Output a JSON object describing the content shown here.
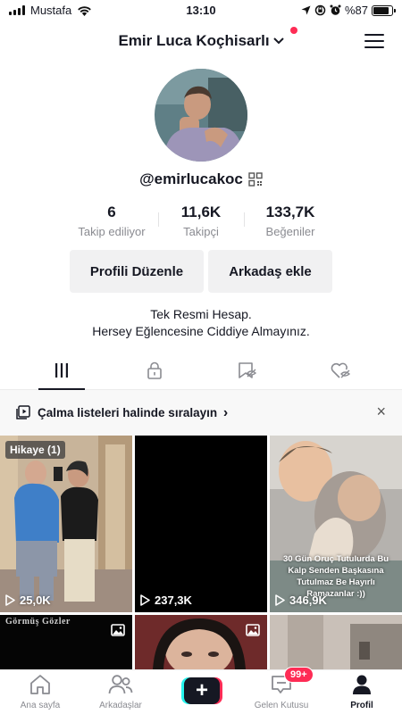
{
  "status_bar": {
    "carrier": "Mustafa",
    "time": "13:10",
    "battery": "%87",
    "battery_level": 0.87
  },
  "header": {
    "display_name": "Emir Luca Koçhisarlı"
  },
  "profile": {
    "username": "@emirlucakoc",
    "stats": [
      {
        "value": "6",
        "label": "Takip ediliyor"
      },
      {
        "value": "11,6K",
        "label": "Takipçi"
      },
      {
        "value": "133,7K",
        "label": "Beğeniler"
      }
    ],
    "edit_profile_label": "Profili Düzenle",
    "add_friend_label": "Arkadaş ekle",
    "bio_line1": "Tek Resmi Hesap.",
    "bio_line2": "Hersey Eğlencesine Ciddiye Almayınız."
  },
  "tabs": [
    {
      "icon": "videos-grid-icon",
      "active": true
    },
    {
      "icon": "lock-icon",
      "active": false
    },
    {
      "icon": "bookmark-icon",
      "active": false
    },
    {
      "icon": "liked-heart-icon",
      "active": false
    }
  ],
  "playlist_banner": {
    "text": "Çalma listeleri halinde sıralayın",
    "chevron": "›",
    "close": "×"
  },
  "videos": [
    {
      "badge": "Hikaye (1)",
      "views": "25,0K"
    },
    {
      "views": "237,3K"
    },
    {
      "views": "346,9K",
      "caption": "30 Gün Oruç Tutulurda Bu Kalp Senden Başkasına Tutulmaz Be Hayırlı Ramazanlar :))"
    },
    {
      "overlay_text": "Görmüş Gözler"
    },
    {},
    {}
  ],
  "bottom_nav": {
    "home_label": "Ana sayfa",
    "friends_label": "Arkadaşlar",
    "create_label": "+",
    "inbox_label": "Gelen Kutusu",
    "inbox_badge": "99+",
    "profile_label": "Profil"
  },
  "colors": {
    "accent_red": "#fe2c55",
    "accent_cyan": "#25f4ee",
    "text_primary": "#161823",
    "text_secondary": "#8a8b91"
  }
}
